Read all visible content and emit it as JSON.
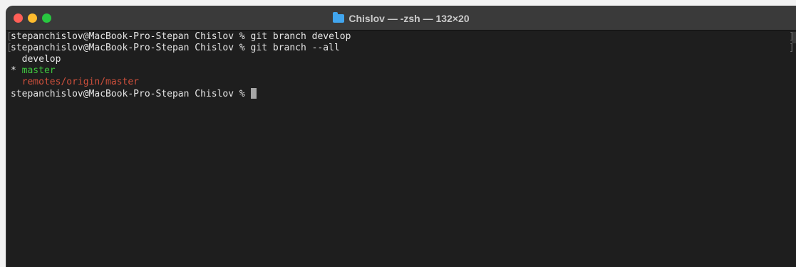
{
  "window": {
    "title": "Chislov — -zsh — 132×20",
    "title_icon": "folder-icon"
  },
  "terminal": {
    "lines": [
      {
        "text": "stepanchislov@MacBook-Pro-Stepan Chislov % git branch develop"
      },
      {
        "text": "stepanchislov@MacBook-Pro-Stepan Chislov % git branch --all"
      },
      {
        "text": "  develop"
      },
      {
        "prefix": "* ",
        "text": "master"
      },
      {
        "text": "  remotes/origin/master"
      },
      {
        "text": "stepanchislov@MacBook-Pro-Stepan Chislov % "
      }
    ],
    "colors": {
      "current_branch": "#3fc83f",
      "remote_branch": "#d0503c",
      "foreground": "#e6e6e6",
      "background": "#1e1e1e"
    }
  }
}
